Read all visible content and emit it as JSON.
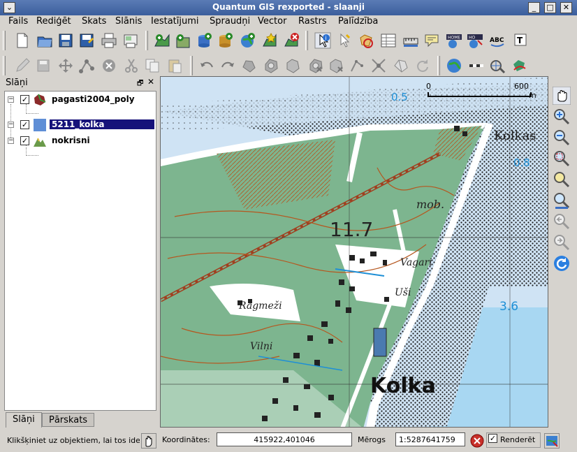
{
  "window": {
    "title": "Quantum GIS rexported - slaanji",
    "menu_glyph": "⌄",
    "min_glyph": "_",
    "max_glyph": "□",
    "close_glyph": "✕"
  },
  "menu": [
    "Fails",
    "Rediģēt",
    "Skats",
    "Slānis",
    "Iestatījumi",
    "Spraudņi",
    "Vector",
    "Rastrs",
    "Palīdzība"
  ],
  "layers_panel": {
    "title": "Slāņi",
    "float_glyph": "🗗",
    "close_glyph": "✕",
    "layers": [
      {
        "name": "pagasti2004_poly",
        "checked": true,
        "selected": false,
        "expanded": true
      },
      {
        "name": "5211_kolka",
        "checked": true,
        "selected": true,
        "expanded": true
      },
      {
        "name": "nokrisni",
        "checked": true,
        "selected": false,
        "expanded": true
      }
    ],
    "expander_glyph": "−",
    "check_glyph": "✓",
    "tabs": [
      {
        "label": "Slāņi",
        "active": true
      },
      {
        "label": "Pārskats",
        "active": false
      }
    ]
  },
  "map": {
    "scalebar": {
      "start": "0",
      "end": "600",
      "unit": "m"
    },
    "labels": {
      "kolkas": "Kolkas",
      "kolka": "Kolka",
      "elev": "11.7",
      "mob": "mob.",
      "vagari": "Vagari",
      "usi": "Uši",
      "ragmezi": "Ragmeži",
      "vilni": "Vilņi",
      "depth_05": "0.5",
      "depth_08": "0.8",
      "depth_36": "3.6"
    },
    "colors": {
      "sea": "#cfe3f4",
      "sea_deep": "#4fb3e8",
      "forest": "#7db58f",
      "sand": "#ffffff",
      "contour": "#b5571f",
      "text_blue": "#1e8fd6"
    }
  },
  "statusbar": {
    "message": "Klikšķiniet uz objektiem, lai tos identificētu",
    "coords_label": "Koordinātes:",
    "coords_value": "415922,401046",
    "scale_label": "Mērogs",
    "scale_value": "1:5287641759",
    "render_label": "Renderēt",
    "render_checked": true,
    "check_glyph": "✓"
  }
}
